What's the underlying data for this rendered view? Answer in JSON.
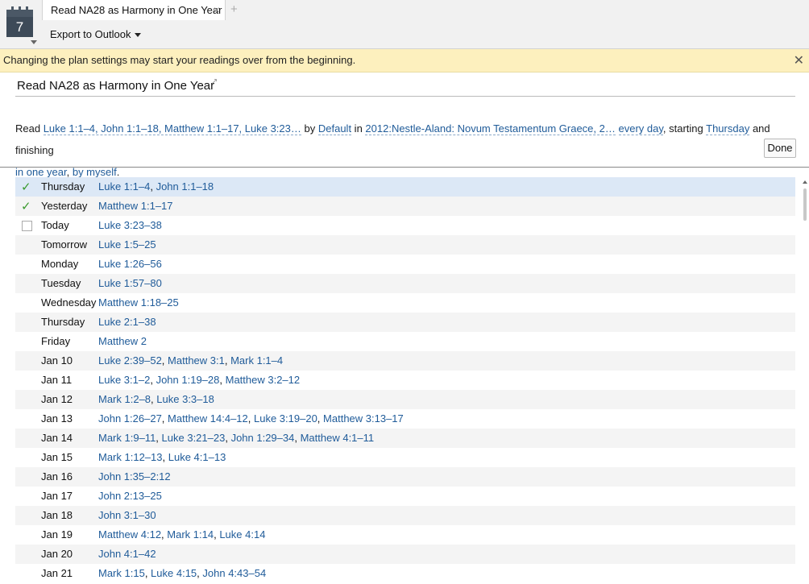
{
  "app": {
    "calendar_day": "7",
    "tab_title": "Read NA28 as Harmony in One Year",
    "tab_close": "×",
    "tab_add": "+",
    "export_label": "Export to Outlook"
  },
  "warning": {
    "text": "Changing the plan settings may start your readings over from the beginning.",
    "close": "✕"
  },
  "plan": {
    "title": "Read NA28 as Harmony in One Year",
    "edit_icon": "↗",
    "settings": {
      "w_read": "Read ",
      "readings": "Luke 1:1–4, John 1:1–18, Matthew 1:1–17, Luke 3:23…",
      "w_by": " by ",
      "order": "Default",
      "w_in": " in ",
      "resource": "2012:Nestle-Aland: Novum Testamentum Graece, 2…",
      "w_sp": " ",
      "frequency": "every day",
      "w_starting": ", starting ",
      "start_day": "Thursday",
      "w_finishing": " and finishing",
      "duration": "in one year",
      "w_comma": ", ",
      "who": "by myself",
      "w_period": "."
    },
    "done_label": "Done"
  },
  "schedule": [
    {
      "day": "Thursday",
      "status": "done",
      "readings": [
        "Luke 1:1–4",
        "John 1:1–18"
      ]
    },
    {
      "day": "Yesterday",
      "status": "done",
      "readings": [
        "Matthew 1:1–17"
      ]
    },
    {
      "day": "Today",
      "status": "todo",
      "readings": [
        "Luke 3:23–38"
      ]
    },
    {
      "day": "Tomorrow",
      "status": "none",
      "readings": [
        "Luke 1:5–25"
      ]
    },
    {
      "day": "Monday",
      "status": "none",
      "readings": [
        "Luke 1:26–56"
      ]
    },
    {
      "day": "Tuesday",
      "status": "none",
      "readings": [
        "Luke 1:57–80"
      ]
    },
    {
      "day": "Wednesday",
      "status": "none",
      "readings": [
        "Matthew 1:18–25"
      ]
    },
    {
      "day": "Thursday",
      "status": "none",
      "readings": [
        "Luke 2:1–38"
      ]
    },
    {
      "day": "Friday",
      "status": "none",
      "readings": [
        "Matthew 2"
      ]
    },
    {
      "day": "Jan 10",
      "status": "none",
      "readings": [
        "Luke 2:39–52",
        "Matthew 3:1",
        "Mark 1:1–4"
      ]
    },
    {
      "day": "Jan 11",
      "status": "none",
      "readings": [
        "Luke 3:1–2",
        "John 1:19–28",
        "Matthew 3:2–12"
      ]
    },
    {
      "day": "Jan 12",
      "status": "none",
      "readings": [
        "Mark 1:2–8",
        "Luke 3:3–18"
      ]
    },
    {
      "day": "Jan 13",
      "status": "none",
      "readings": [
        "John 1:26–27",
        "Matthew 14:4–12",
        "Luke 3:19–20",
        "Matthew 3:13–17"
      ]
    },
    {
      "day": "Jan 14",
      "status": "none",
      "readings": [
        "Mark 1:9–11",
        "Luke 3:21–23",
        "John 1:29–34",
        "Matthew 4:1–11"
      ]
    },
    {
      "day": "Jan 15",
      "status": "none",
      "readings": [
        "Mark 1:12–13",
        "Luke 4:1–13"
      ]
    },
    {
      "day": "Jan 16",
      "status": "none",
      "readings": [
        "John 1:35–2:12"
      ]
    },
    {
      "day": "Jan 17",
      "status": "none",
      "readings": [
        "John 2:13–25"
      ]
    },
    {
      "day": "Jan 18",
      "status": "none",
      "readings": [
        "John 3:1–30"
      ]
    },
    {
      "day": "Jan 19",
      "status": "none",
      "readings": [
        "Matthew 4:12",
        "Mark 1:14",
        "Luke 4:14"
      ]
    },
    {
      "day": "Jan 20",
      "status": "none",
      "readings": [
        "John 4:1–42"
      ]
    },
    {
      "day": "Jan 21",
      "status": "none",
      "readings": [
        "Mark 1:15",
        "Luke 4:15",
        "John 4:43–54"
      ]
    }
  ],
  "colors": {
    "link": "#1f5b99",
    "check": "#3a9a2e",
    "warning_bg": "#fdf0be",
    "highlight_row": "#dce8f6"
  }
}
